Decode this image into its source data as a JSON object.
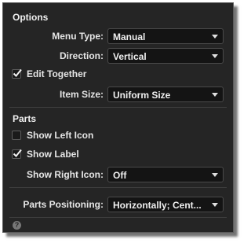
{
  "options": {
    "title": "Options",
    "menu_type": {
      "label": "Menu Type:",
      "value": "Manual"
    },
    "direction": {
      "label": "Direction:",
      "value": "Vertical"
    },
    "edit_together": {
      "label": "Edit Together",
      "checked": true
    },
    "item_size": {
      "label": "Item Size:",
      "value": "Uniform Size"
    }
  },
  "parts": {
    "title": "Parts",
    "show_left_icon": {
      "label": "Show Left Icon",
      "checked": false
    },
    "show_label": {
      "label": "Show Label",
      "checked": true
    },
    "show_right_icon": {
      "label": "Show Right Icon:",
      "value": "Off"
    },
    "parts_positioning": {
      "label": "Parts Positioning:",
      "value": "Horizontally; Cent..."
    }
  },
  "footer": {
    "help_glyph": "?",
    "help_icon": "question-circle-icon"
  },
  "colors": {
    "panel_bg": "#252525",
    "dropdown_bg": "#141414",
    "text": "#e6e6e6"
  }
}
